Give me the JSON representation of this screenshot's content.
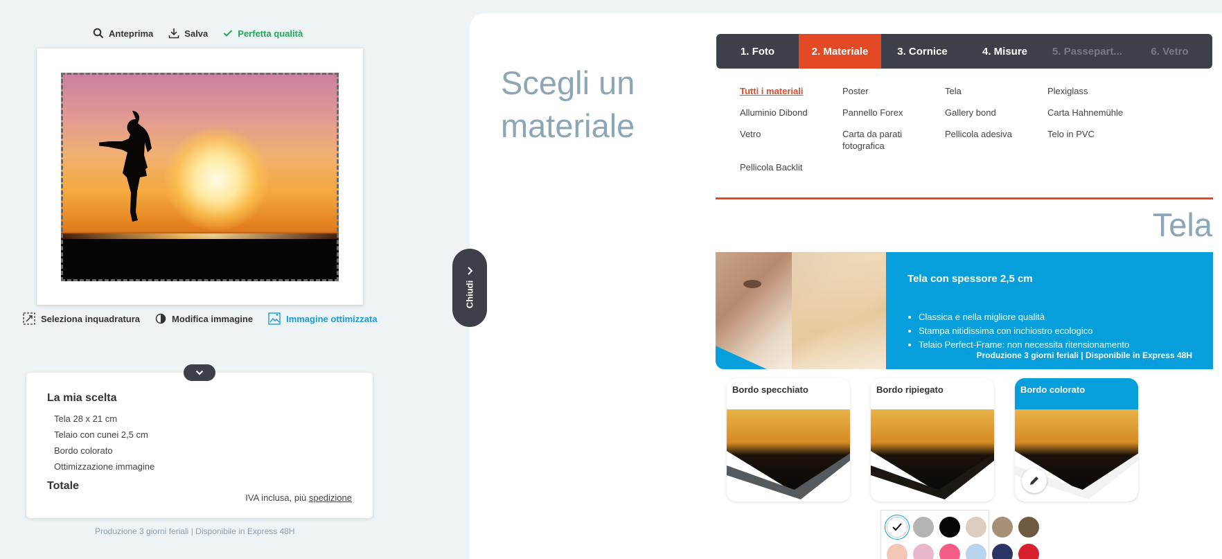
{
  "toolbar": {
    "preview": "Anteprima",
    "save": "Salva",
    "quality": "Perfetta qualità",
    "quality_color": "#1faa55"
  },
  "image_actions": {
    "crop": "Seleziona inquadratura",
    "edit": "Modifica immagine",
    "optimized": "Immagine ottimizzata"
  },
  "choice": {
    "title": "La mia scelta",
    "items": [
      "Tela 28 x 21 cm",
      "Telaio con cunei 2,5 cm",
      "Bordo colorato",
      "Ottimizzazione immagine"
    ],
    "total_label": "Totale",
    "iva_text": "IVA inclusa, più",
    "shipping_link": "spedizione"
  },
  "left_footer": "Produzione 3 giorni feriali | Disponibile in Express 48H",
  "close_handle": "Chiudi",
  "page_title": "Scegli un materiale",
  "steps": [
    {
      "label": "1. Foto",
      "state": "done"
    },
    {
      "label": "2. Materiale",
      "state": "active"
    },
    {
      "label": "3. Cornice",
      "state": "enabled"
    },
    {
      "label": "4. Misure",
      "state": "enabled"
    },
    {
      "label": "5. Passepart...",
      "state": "disabled"
    },
    {
      "label": "6. Vetro",
      "state": "disabled"
    }
  ],
  "materials": [
    {
      "label": "Tutti i materiali",
      "active": true
    },
    {
      "label": "Poster"
    },
    {
      "label": "Tela"
    },
    {
      "label": "Plexiglass"
    },
    {
      "label": "Alluminio Dibond"
    },
    {
      "label": "Pannello Forex"
    },
    {
      "label": "Gallery bond"
    },
    {
      "label": "Carta Hahnemühle"
    },
    {
      "label": "Vetro"
    },
    {
      "label": "Carta da parati fotografica"
    },
    {
      "label": "Pellicola adesiva"
    },
    {
      "label": "Telo in PVC"
    },
    {
      "label": "Pellicola Backlit"
    }
  ],
  "section_title": "Tela",
  "banner": {
    "title": "Tela con spessore 2,5 cm",
    "bullets": [
      "Classica e nella migliore qualità",
      "Stampa nitidissima con inchiostro ecologico",
      "Telaio Perfect-Frame: non necessita ritensionamento"
    ],
    "footer": "Produzione 3 giorni feriali | Disponibile in Express 48H",
    "color": "#079fdb"
  },
  "edges": [
    {
      "label": "Bordo specchiato",
      "selected": false
    },
    {
      "label": "Bordo ripiegato",
      "selected": false
    },
    {
      "label": "Bordo colorato",
      "selected": true
    }
  ],
  "palette": [
    {
      "color": "#ffffff",
      "selected": true
    },
    {
      "color": "#b4b4b4"
    },
    {
      "color": "#050505"
    },
    {
      "color": "#ddcdbf"
    },
    {
      "color": "#a88f78"
    },
    {
      "color": "#6e5a41"
    },
    {
      "color": "#f4c7b5"
    },
    {
      "color": "#e9b8cc"
    },
    {
      "color": "#f25d86"
    },
    {
      "color": "#b9d4ee"
    },
    {
      "color": "#2c3365"
    },
    {
      "color": "#d81f2c"
    }
  ],
  "accent_color": "#e44926"
}
